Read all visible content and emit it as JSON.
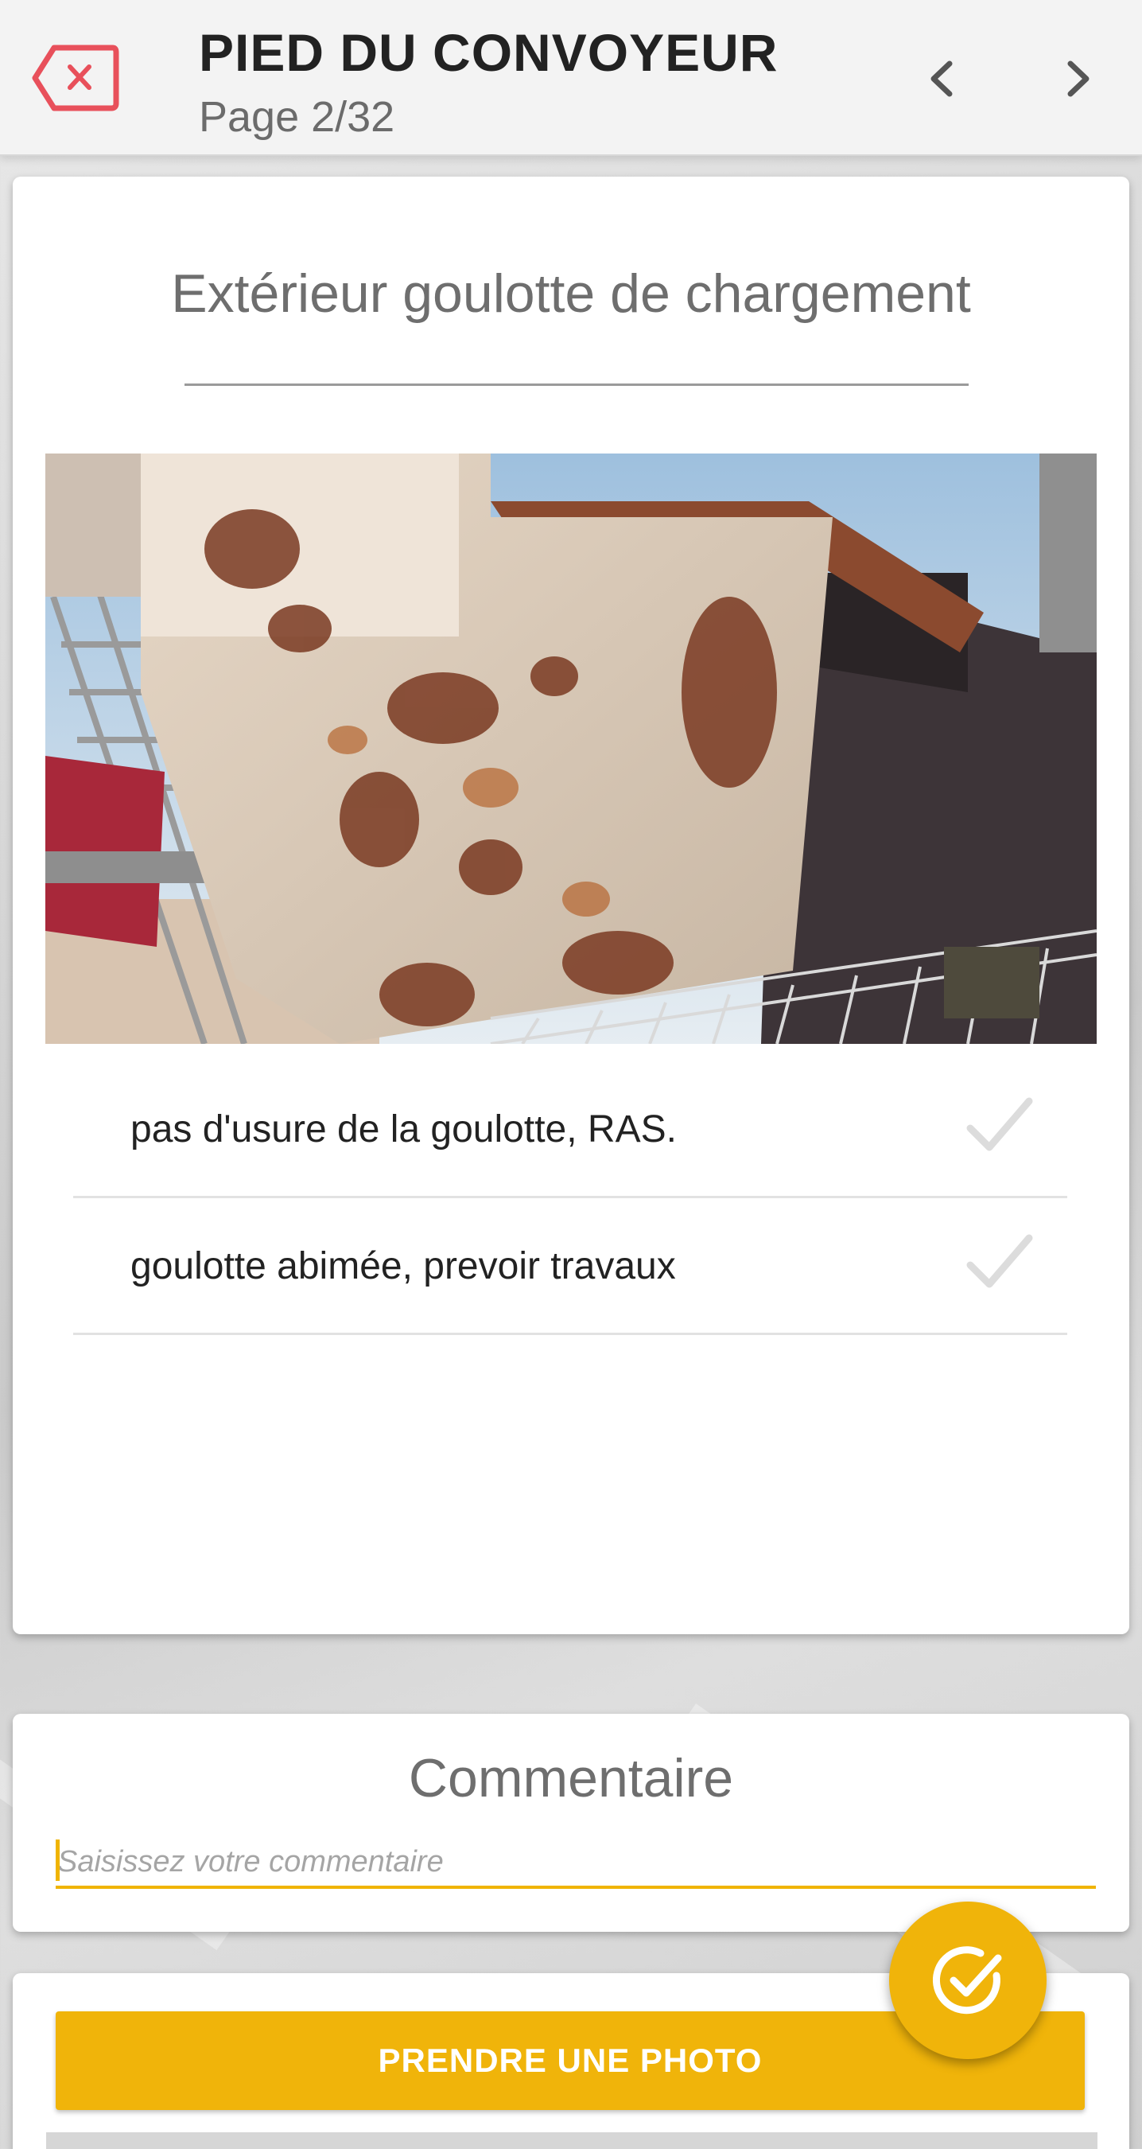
{
  "header": {
    "title": "PIED DU CONVOYEUR",
    "page_label": "Page 2/32",
    "icons": {
      "close": "close-tag-icon",
      "prev": "chevron-left-icon",
      "next": "chevron-right-icon"
    },
    "accent_color": "#e8505b"
  },
  "question": {
    "title": "Extérieur goulotte de chargement",
    "image_description": "rusty conveyor loading chute",
    "options": [
      {
        "label": "pas d'usure de la goulotte, RAS.",
        "icon": "check-icon"
      },
      {
        "label": "goulotte abimée, prevoir travaux",
        "icon": "check-icon"
      }
    ]
  },
  "comment": {
    "title": "Commentaire",
    "placeholder": "Saisissez votre commentaire",
    "value": ""
  },
  "actions": {
    "take_photo_label": "PRENDRE UNE PHOTO",
    "validate_icon": "check-circle-icon",
    "brand_color": "#f0b40a"
  }
}
